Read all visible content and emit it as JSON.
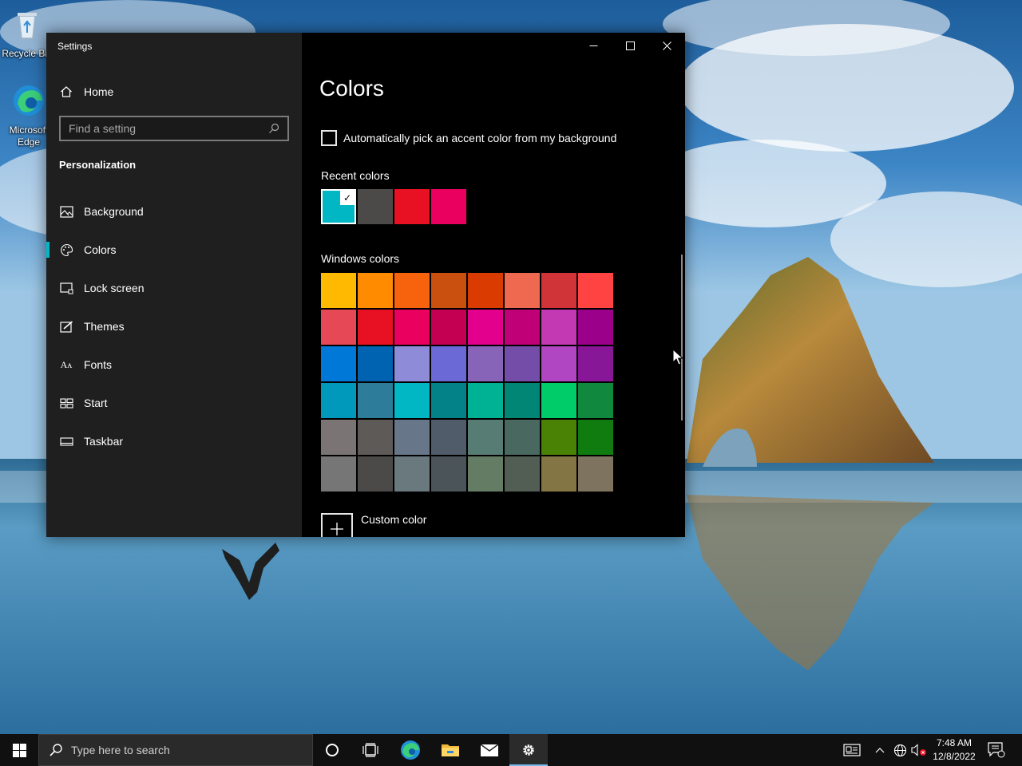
{
  "desktop": {
    "icons": [
      {
        "label": "Recycle Bin",
        "icon": "recycle-bin-icon"
      },
      {
        "label": "Microsoft Edge",
        "icon": "edge-icon"
      }
    ]
  },
  "window": {
    "title": "Settings",
    "controls": {
      "minimize": "minimize-icon",
      "maximize": "maximize-icon",
      "close": "close-icon"
    }
  },
  "sidebar": {
    "home_label": "Home",
    "search_placeholder": "Find a setting",
    "section_title": "Personalization",
    "items": [
      {
        "label": "Background",
        "icon": "picture-icon",
        "active": false
      },
      {
        "label": "Colors",
        "icon": "palette-icon",
        "active": true
      },
      {
        "label": "Lock screen",
        "icon": "lock-screen-icon",
        "active": false
      },
      {
        "label": "Themes",
        "icon": "themes-icon",
        "active": false
      },
      {
        "label": "Fonts",
        "icon": "fonts-icon",
        "active": false
      },
      {
        "label": "Start",
        "icon": "start-icon",
        "active": false
      },
      {
        "label": "Taskbar",
        "icon": "taskbar-icon",
        "active": false
      }
    ],
    "accent_color": "#00b7c3"
  },
  "content": {
    "page_title": "Colors",
    "auto_accent_label": "Automatically pick an accent color from my background",
    "auto_accent_checked": false,
    "recent_colors_label": "Recent colors",
    "recent_colors": [
      "#00b7c3",
      "#4c4a48",
      "#e81123",
      "#ea005e"
    ],
    "recent_selected_index": 0,
    "windows_colors_label": "Windows colors",
    "windows_colors": [
      [
        "#ffb900",
        "#ff8c00",
        "#f7630c",
        "#ca5010",
        "#da3b01",
        "#ef6950",
        "#d13438",
        "#ff4343"
      ],
      [
        "#e74856",
        "#e81123",
        "#ea005e",
        "#c30052",
        "#e3008c",
        "#bf0077",
        "#c239b3",
        "#9a0089"
      ],
      [
        "#0078d7",
        "#0063b1",
        "#8e8cd8",
        "#6b69d6",
        "#8764b8",
        "#744da9",
        "#b146c2",
        "#881798"
      ],
      [
        "#0099bc",
        "#2d7d9a",
        "#00b7c3",
        "#038387",
        "#00b294",
        "#018574",
        "#00cc6a",
        "#10893e"
      ],
      [
        "#7a7574",
        "#5d5a58",
        "#68768a",
        "#515c6b",
        "#567c73",
        "#486860",
        "#498205",
        "#107c10"
      ],
      [
        "#767676",
        "#4c4a48",
        "#69797e",
        "#4a5459",
        "#647c64",
        "#525e54",
        "#847545",
        "#7e735f"
      ]
    ],
    "custom_color_label": "Custom color"
  },
  "taskbar": {
    "search_placeholder": "Type here to search",
    "buttons": [
      {
        "name": "cortana",
        "icon": "cortana-circle-icon"
      },
      {
        "name": "task-view",
        "icon": "task-view-icon"
      },
      {
        "name": "edge",
        "icon": "edge-icon"
      },
      {
        "name": "file-explorer",
        "icon": "folder-icon"
      },
      {
        "name": "mail",
        "icon": "mail-icon"
      },
      {
        "name": "settings",
        "icon": "gear-icon",
        "active": true
      }
    ],
    "tray": {
      "time": "7:48 AM",
      "date": "12/8/2022"
    }
  }
}
